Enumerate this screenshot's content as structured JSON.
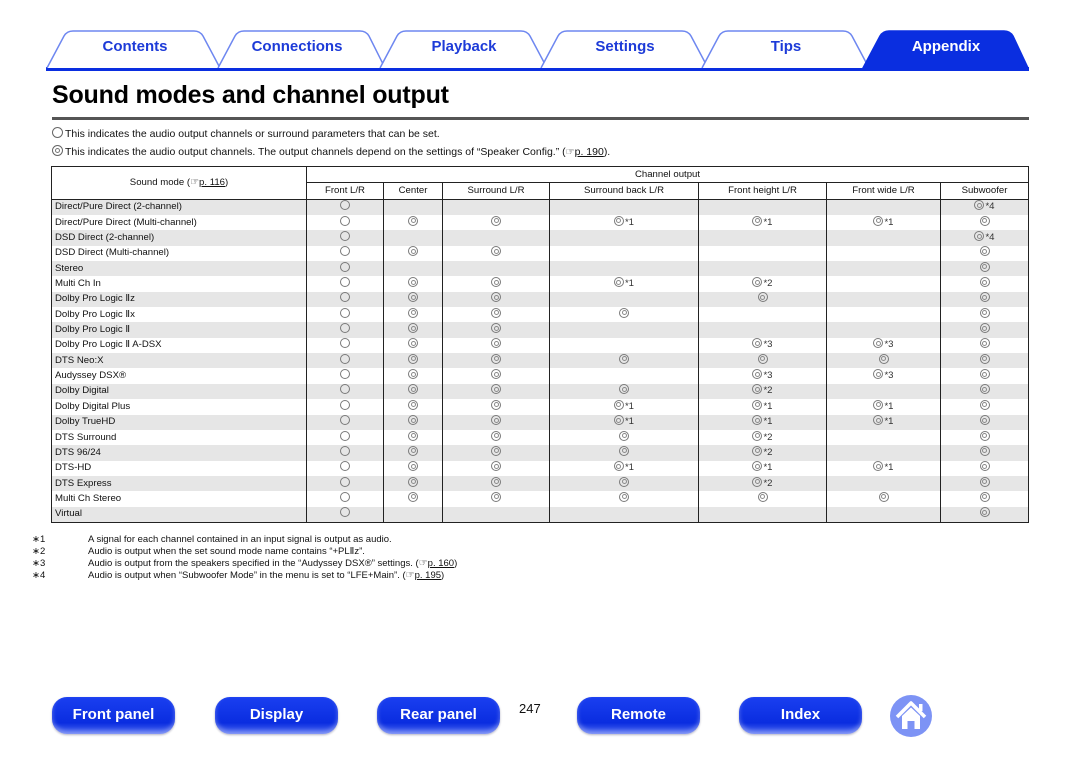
{
  "tabs": [
    {
      "label": "Contents",
      "active": false
    },
    {
      "label": "Connections",
      "active": false
    },
    {
      "label": "Playback",
      "active": false
    },
    {
      "label": "Settings",
      "active": false
    },
    {
      "label": "Tips",
      "active": false
    },
    {
      "label": "Appendix",
      "active": true
    }
  ],
  "title": "Sound modes and channel output",
  "notes": [
    {
      "symbol": "single-circle",
      "text": "This indicates the audio output channels or surround parameters that can be set."
    },
    {
      "symbol": "double-circle",
      "text": "This indicates the audio output channels. The output channels depend on the settings of “Speaker Config.” (",
      "ref": "p. 190",
      "tail": ")."
    }
  ],
  "table": {
    "mode_header": "Sound mode (",
    "mode_header_ref": "p. 116",
    "mode_header_tail": ")",
    "group_header": "Channel output",
    "columns": [
      "Front L/R",
      "Center",
      "Surround L/R",
      "Surround back L/R",
      "Front height L/R",
      "Front wide L/R",
      "Subwoofer"
    ],
    "legend": {
      "o": "single circle (settable)",
      "d": "double circle (output channel)"
    },
    "rows": [
      {
        "mode": "Direct/Pure Direct (2-channel)",
        "cells": [
          "o",
          "",
          "",
          "",
          "",
          "",
          "d*4"
        ]
      },
      {
        "mode": "Direct/Pure Direct (Multi-channel)",
        "cells": [
          "o",
          "d",
          "d",
          "d*1",
          "d*1",
          "d*1",
          "d"
        ]
      },
      {
        "mode": "DSD Direct (2-channel)",
        "cells": [
          "o",
          "",
          "",
          "",
          "",
          "",
          "d*4"
        ]
      },
      {
        "mode": "DSD Direct (Multi-channel)",
        "cells": [
          "o",
          "d",
          "d",
          "",
          "",
          "",
          "d"
        ]
      },
      {
        "mode": "Stereo",
        "cells": [
          "o",
          "",
          "",
          "",
          "",
          "",
          "d"
        ]
      },
      {
        "mode": "Multi Ch In",
        "cells": [
          "o",
          "d",
          "d",
          "d*1",
          "d*2",
          "",
          "d"
        ]
      },
      {
        "mode": "Dolby Pro Logic Ⅱz",
        "cells": [
          "o",
          "d",
          "d",
          "",
          "d",
          "",
          "d"
        ]
      },
      {
        "mode": "Dolby Pro Logic Ⅱx",
        "cells": [
          "o",
          "d",
          "d",
          "d",
          "",
          "",
          "d"
        ]
      },
      {
        "mode": "Dolby Pro Logic Ⅱ",
        "cells": [
          "o",
          "d",
          "d",
          "",
          "",
          "",
          "d"
        ]
      },
      {
        "mode": "Dolby Pro Logic Ⅱ A-DSX",
        "cells": [
          "o",
          "d",
          "d",
          "",
          "d*3",
          "d*3",
          "d"
        ]
      },
      {
        "mode": "DTS Neo:X",
        "cells": [
          "o",
          "d",
          "d",
          "d",
          "d",
          "d",
          "d"
        ]
      },
      {
        "mode": "Audyssey DSX®",
        "cells": [
          "o",
          "d",
          "d",
          "",
          "d*3",
          "d*3",
          "d"
        ]
      },
      {
        "mode": "Dolby Digital",
        "cells": [
          "o",
          "d",
          "d",
          "d",
          "d*2",
          "",
          "d"
        ]
      },
      {
        "mode": "Dolby Digital Plus",
        "cells": [
          "o",
          "d",
          "d",
          "d*1",
          "d*1",
          "d*1",
          "d"
        ]
      },
      {
        "mode": "Dolby TrueHD",
        "cells": [
          "o",
          "d",
          "d",
          "d*1",
          "d*1",
          "d*1",
          "d"
        ]
      },
      {
        "mode": "DTS Surround",
        "cells": [
          "o",
          "d",
          "d",
          "d",
          "d*2",
          "",
          "d"
        ]
      },
      {
        "mode": "DTS 96/24",
        "cells": [
          "o",
          "d",
          "d",
          "d",
          "d*2",
          "",
          "d"
        ]
      },
      {
        "mode": "DTS-HD",
        "cells": [
          "o",
          "d",
          "d",
          "d*1",
          "d*1",
          "d*1",
          "d"
        ]
      },
      {
        "mode": "DTS Express",
        "cells": [
          "o",
          "d",
          "d",
          "d",
          "d*2",
          "",
          "d"
        ]
      },
      {
        "mode": "Multi Ch Stereo",
        "cells": [
          "o",
          "d",
          "d",
          "d",
          "d",
          "d",
          "d"
        ]
      },
      {
        "mode": "Virtual",
        "cells": [
          "o",
          "",
          "",
          "",
          "",
          "",
          "d"
        ]
      }
    ]
  },
  "footnotes": [
    {
      "key": "∗1",
      "text": "A signal for each channel contained in an input signal is output as audio."
    },
    {
      "key": "∗2",
      "text": "Audio is output when the set sound mode name contains “+PLⅡz”."
    },
    {
      "key": "∗3",
      "text": "Audio is output from the speakers specified in the “Audyssey DSX®” settings.  (",
      "ref": "p. 160",
      "tail": ")"
    },
    {
      "key": "∗4",
      "text": "Audio is output when “Subwoofer Mode” in the menu is set to “LFE+Main”.  (",
      "ref": "p. 195",
      "tail": ")"
    }
  ],
  "ref_icon": "pointing-hand-icon",
  "bottom_nav": {
    "front_panel": "Front panel",
    "display": "Display",
    "rear_panel": "Rear panel",
    "page_number": "247",
    "remote": "Remote",
    "index": "Index",
    "home_icon": "home-icon"
  },
  "colors": {
    "accent": "#0a2ee0",
    "tab_text": "#1d3bd8",
    "home": "#7d93f5",
    "row_alt": "#e6e6e6"
  }
}
